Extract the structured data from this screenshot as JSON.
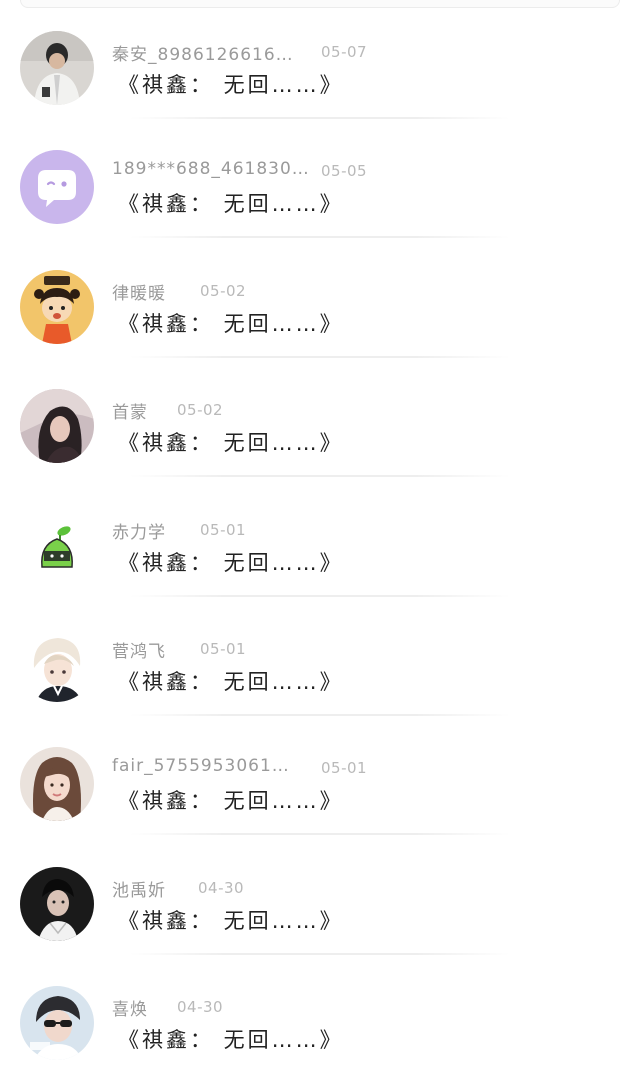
{
  "messages": [
    {
      "name": "秦安_8986126616…",
      "date": "05-07",
      "text": "《祺鑫： 无回……》",
      "avatar": "person-white-jacket"
    },
    {
      "name": "189***688_461830…",
      "date": "05-05",
      "text": "《祺鑫： 无回……》",
      "avatar": "purple-chat-bubble"
    },
    {
      "name": "律暖暖",
      "date": "05-02",
      "text": "《祺鑫： 无回……》",
      "avatar": "cartoon-girl-orange"
    },
    {
      "name": "首蒙",
      "date": "05-02",
      "text": "《祺鑫： 无回……》",
      "avatar": "dark-hair-girl"
    },
    {
      "name": "赤力学",
      "date": "05-01",
      "text": "《祺鑫： 无回……》",
      "avatar": "green-sprout-mascot"
    },
    {
      "name": "菅鸿飞",
      "date": "05-01",
      "text": "《祺鑫： 无回……》",
      "avatar": "anime-boy"
    },
    {
      "name": "fair_5755953061…",
      "date": "05-01",
      "text": "《祺鑫： 无回……》",
      "avatar": "girl-portrait"
    },
    {
      "name": "池禹妡",
      "date": "04-30",
      "text": "《祺鑫： 无回……》",
      "avatar": "boy-dark-portrait"
    },
    {
      "name": "喜焕",
      "date": "04-30",
      "text": "《祺鑫： 无回……》",
      "avatar": "boy-sunglasses"
    }
  ],
  "colors": {
    "name": "#9a9a9a",
    "date": "#b9b9b9",
    "message": "#222222",
    "divider": "#eeeeee"
  }
}
